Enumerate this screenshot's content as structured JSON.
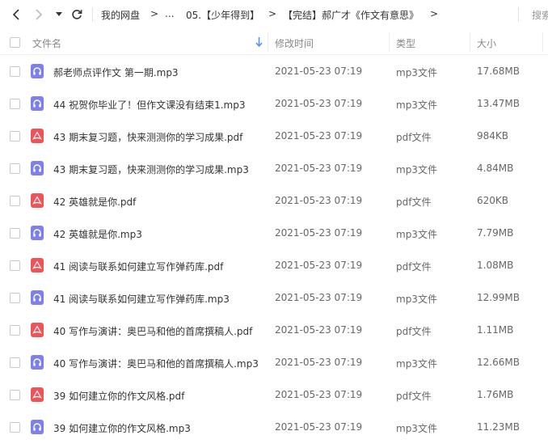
{
  "toolbar": {
    "breadcrumb": [
      {
        "label": "我的网盘"
      },
      {
        "label": "..."
      },
      {
        "label": "05.【少年得到】"
      },
      {
        "label": "【完结】郝广才《作文有意思》"
      }
    ],
    "search_placeholder": "搜索"
  },
  "columns": {
    "name": "文件名",
    "modified": "修改时间",
    "type": "类型",
    "size": "大小"
  },
  "colors": {
    "mp3_icon": "#7d7ff0",
    "pdf_icon": "#f0525a",
    "sort_arrow": "#4d8ef7"
  },
  "files": [
    {
      "name": "郝老师点评作文 第一期.mp3",
      "modified": "2021-05-23 07:19",
      "type": "mp3文件",
      "size": "17.68MB",
      "icon": "headphones-icon",
      "kind": "mp3"
    },
    {
      "name": "44 祝贺你毕业了！但作文课没有结束1.mp3",
      "modified": "2021-05-23 07:19",
      "type": "mp3文件",
      "size": "13.47MB",
      "icon": "headphones-icon",
      "kind": "mp3"
    },
    {
      "name": "43 期末复习题，快来测测你的学习成果.pdf",
      "modified": "2021-05-23 07:19",
      "type": "pdf文件",
      "size": "984KB",
      "icon": "pdf-icon",
      "kind": "pdf"
    },
    {
      "name": "43 期末复习题，快来测测你的学习成果.mp3",
      "modified": "2021-05-23 07:19",
      "type": "mp3文件",
      "size": "4.84MB",
      "icon": "headphones-icon",
      "kind": "mp3"
    },
    {
      "name": "42 英雄就是你.pdf",
      "modified": "2021-05-23 07:19",
      "type": "pdf文件",
      "size": "620KB",
      "icon": "pdf-icon",
      "kind": "pdf"
    },
    {
      "name": "42 英雄就是你.mp3",
      "modified": "2021-05-23 07:19",
      "type": "mp3文件",
      "size": "7.79MB",
      "icon": "headphones-icon",
      "kind": "mp3"
    },
    {
      "name": "41 阅读与联系如何建立写作弹药库.pdf",
      "modified": "2021-05-23 07:19",
      "type": "pdf文件",
      "size": "1.08MB",
      "icon": "pdf-icon",
      "kind": "pdf"
    },
    {
      "name": "41 阅读与联系如何建立写作弹药库.mp3",
      "modified": "2021-05-23 07:19",
      "type": "mp3文件",
      "size": "12.99MB",
      "icon": "headphones-icon",
      "kind": "mp3"
    },
    {
      "name": "40 写作与演讲：奥巴马和他的首席撰稿人.pdf",
      "modified": "2021-05-23 07:19",
      "type": "pdf文件",
      "size": "1.11MB",
      "icon": "pdf-icon",
      "kind": "pdf"
    },
    {
      "name": "40 写作与演讲：奥巴马和他的首席撰稿人.mp3",
      "modified": "2021-05-23 07:19",
      "type": "mp3文件",
      "size": "12.66MB",
      "icon": "headphones-icon",
      "kind": "mp3"
    },
    {
      "name": "39 如何建立你的作文风格.pdf",
      "modified": "2021-05-23 07:19",
      "type": "pdf文件",
      "size": "1.76MB",
      "icon": "pdf-icon",
      "kind": "pdf"
    },
    {
      "name": "39 如何建立你的作文风格.mp3",
      "modified": "2021-05-23 07:19",
      "type": "mp3文件",
      "size": "11.23MB",
      "icon": "headphones-icon",
      "kind": "mp3"
    }
  ]
}
